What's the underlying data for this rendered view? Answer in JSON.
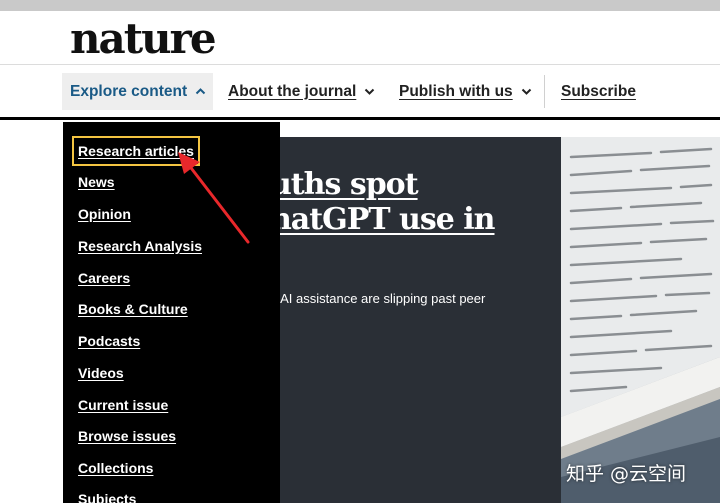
{
  "site": {
    "logo": "nature"
  },
  "nav": {
    "items": [
      {
        "label": "Explore content",
        "chevron": "up"
      },
      {
        "label": "About the journal",
        "chevron": "down"
      },
      {
        "label": "Publish with us",
        "chevron": "down"
      },
      {
        "label": "Subscribe"
      }
    ]
  },
  "dropdown": {
    "items": [
      "Research articles",
      "News",
      "Opinion",
      "Research Analysis",
      "Careers",
      "Books & Culture",
      "Podcasts",
      "Videos",
      "Current issue",
      "Browse issues",
      "Collections",
      "Subjects"
    ],
    "highlighted_index": 0
  },
  "hero": {
    "title_line1": "uths spot",
    "title_line2": "natGPT use in",
    "subtitle": "e AI assistance are slipping past peer"
  },
  "colors": {
    "accent_nav": "#1a5a86",
    "dropdown_bg": "#000000",
    "highlight_outline": "#f4c542",
    "annotation_arrow": "#e8282b",
    "hero_bg": "#2a2f36"
  },
  "watermark": "知乎 @云空间"
}
